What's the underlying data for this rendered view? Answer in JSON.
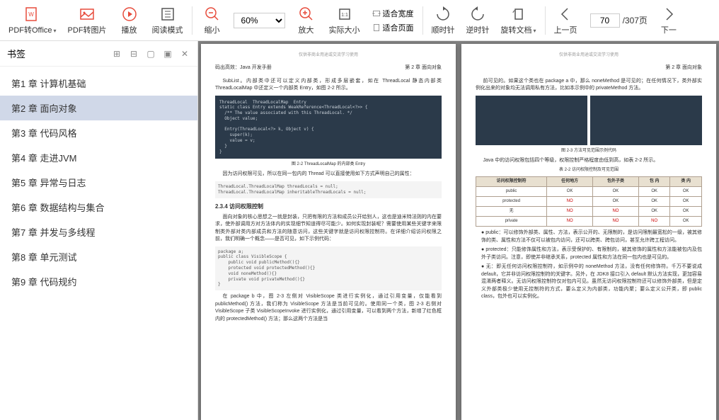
{
  "toolbar": {
    "pdf_convert": "PDF转Office",
    "pdf_image": "PDF转图片",
    "play": "播放",
    "read_mode": "阅读模式",
    "zoom_out": "缩小",
    "zoom_value": "60%",
    "zoom_in": "放大",
    "actual_size": "实际大小",
    "fit_width": "适合宽度",
    "fit_page": "适合页面",
    "rotate_cw": "顺时针",
    "rotate_ccw": "逆时针",
    "rotate_doc": "旋转文档",
    "prev_page": "上一页",
    "next_page": "下一",
    "page_current": "70",
    "page_total": "/307页"
  },
  "sidebar": {
    "title": "书签",
    "items": [
      "第1 章 计算机基础",
      "第2 章 面向对象",
      "第3 章 代码风格",
      "第4 章 走进JVM",
      "第5 章 异常与日志",
      "第6 章 数据结构与集合",
      "第7 章 并发与多线程",
      "第8 章 单元测试",
      "第9 章 代码规约"
    ],
    "active_index": 1
  },
  "page_left": {
    "watermark": "仅供非商业用途或交流学习使用",
    "book_title": "码出高效：Java 开发手册",
    "chapter": "第 2 章  面向对象",
    "para1": "SubList。内部类中还可以定义内部类，形成多层嵌套，如在 ThreadLocal 静态内部类 ThreadLocalMap 中还定义一个内部类 Entry，如图 2-2 所示。",
    "code1": "ThreadLocal  ThreadLocalMap  Entry\nstatic class Entry extends WeakReference<ThreadLocal<?>> {\n  /** The value associated with this ThreadLocal. */\n  Object value;\n\n  Entry(ThreadLocal<?> k, Object v) {\n    super(k);\n    value = v;\n  }\n}",
    "caption1": "图 2-2  ThreadLocalMap 的内部类 Entry",
    "para2": "因为访问权限可见，所以在同一包内的 Thread 可以直接使用如下方式声明自己的属性：",
    "code2": "ThreadLocal.ThreadLocalMap threadLocals = null;\nThreadLocal.ThreadLocalMap inheritableThreadLocals = null;",
    "section": "2.3.4  访问权限控制",
    "para3": "面向对象的核心思想之一就是封装，只把有限的方法和成员公开给别人，这也是迪米特法则的内在要求，使外部调用方对方法体内的实现细节知道得尽可能少。如何实现封装呢？需要使用某些关键字来限制类外部对类内部成员和方法的随意访问，这些关键字就是访问权限控制符。在详细介绍访问权限之前，我们明确一个概念——是否可见，如下示例代码：",
    "code3": "package a;\npublic class VisibleScope {\n    public void publicMethod(){}\n    protected void protectedMethod(){}\n    void noneMethod(){}\n    private void privateMethod(){}\n}",
    "para4": "在 package b 中，图 2-3 左侧对 VisibleScope 类进行实例化，通过引用变量，仅能看到 publicMethod() 方法，我们称为 VisibleScope 方法是当前可见的。使用同一个类，图 2-3 右侧对 VisibleScope 子类 VisibleScopeInvoke 进行实例化，通过引用变量，可以看到两个方法，新增了红色框内的 protectedMethod() 方法；那么这两个方法是当"
  },
  "page_right": {
    "watermark": "仅供非商业用途或交流学习使用",
    "chapter": "第 2 章  面向对象",
    "para1": "前可见的。如果这个类也在 package a 中，那么 noneMethod 是可见的；在任何情况下，类外部实例化出来的对象均无法调用私有方法，比如本示例中的 privateMethod 方法。",
    "caption1": "图 2-3  方法可见范围示例代码",
    "para2": "Java 中的访问权限包括四个等级，权限控制严格程度由低到高，如表 2-2 所示。",
    "table_caption": "表 2-2 访问权限控制及可见范围",
    "table": {
      "headers": [
        "访问权限控制符",
        "任何地方",
        "包外子类",
        "包  内",
        "类  内"
      ],
      "rows": [
        [
          "public",
          "OK",
          "OK",
          "OK",
          "OK"
        ],
        [
          "protected",
          "NO",
          "OK",
          "OK",
          "OK"
        ],
        [
          "无",
          "NO",
          "NO",
          "OK",
          "OK"
        ],
        [
          "private",
          "NO",
          "NO",
          "NO",
          "OK"
        ]
      ]
    },
    "bullets": [
      "public：可以修饰外部类、属性、方法，表示公开的、无限制的，是访问限制最宽松的一级，被其修饰的类、属性和方法不仅可以被包内访问，还可以跨类、跨包访问，甚至允许跨工程访问。",
      "protected：只能修饰属性和方法，表示受保护的、有限制的，被其修饰的属性和方法能被包内及包外子类访问。注意，即使并非继承关系，protected 属性和方法在同一包内也是可见的。",
      "无：即无任何访问权限控制符，如示例中的 noneMethod 方法，没有任何修饰符。千万不要说成 default，它并非访问权限控制符的关键字。另外，在 JDK8 接口引入 default 默认方法实现，更加容易混淆两者释义。无访问权限控制符仅对包内可见。虽然无访问权限控制符还可以修饰外部类，但是定义外部类极少使用无控制符的方式，要么定义为内部类，功能内聚；要么定义公开类，即 public class，包外也可以实例化。"
    ]
  }
}
